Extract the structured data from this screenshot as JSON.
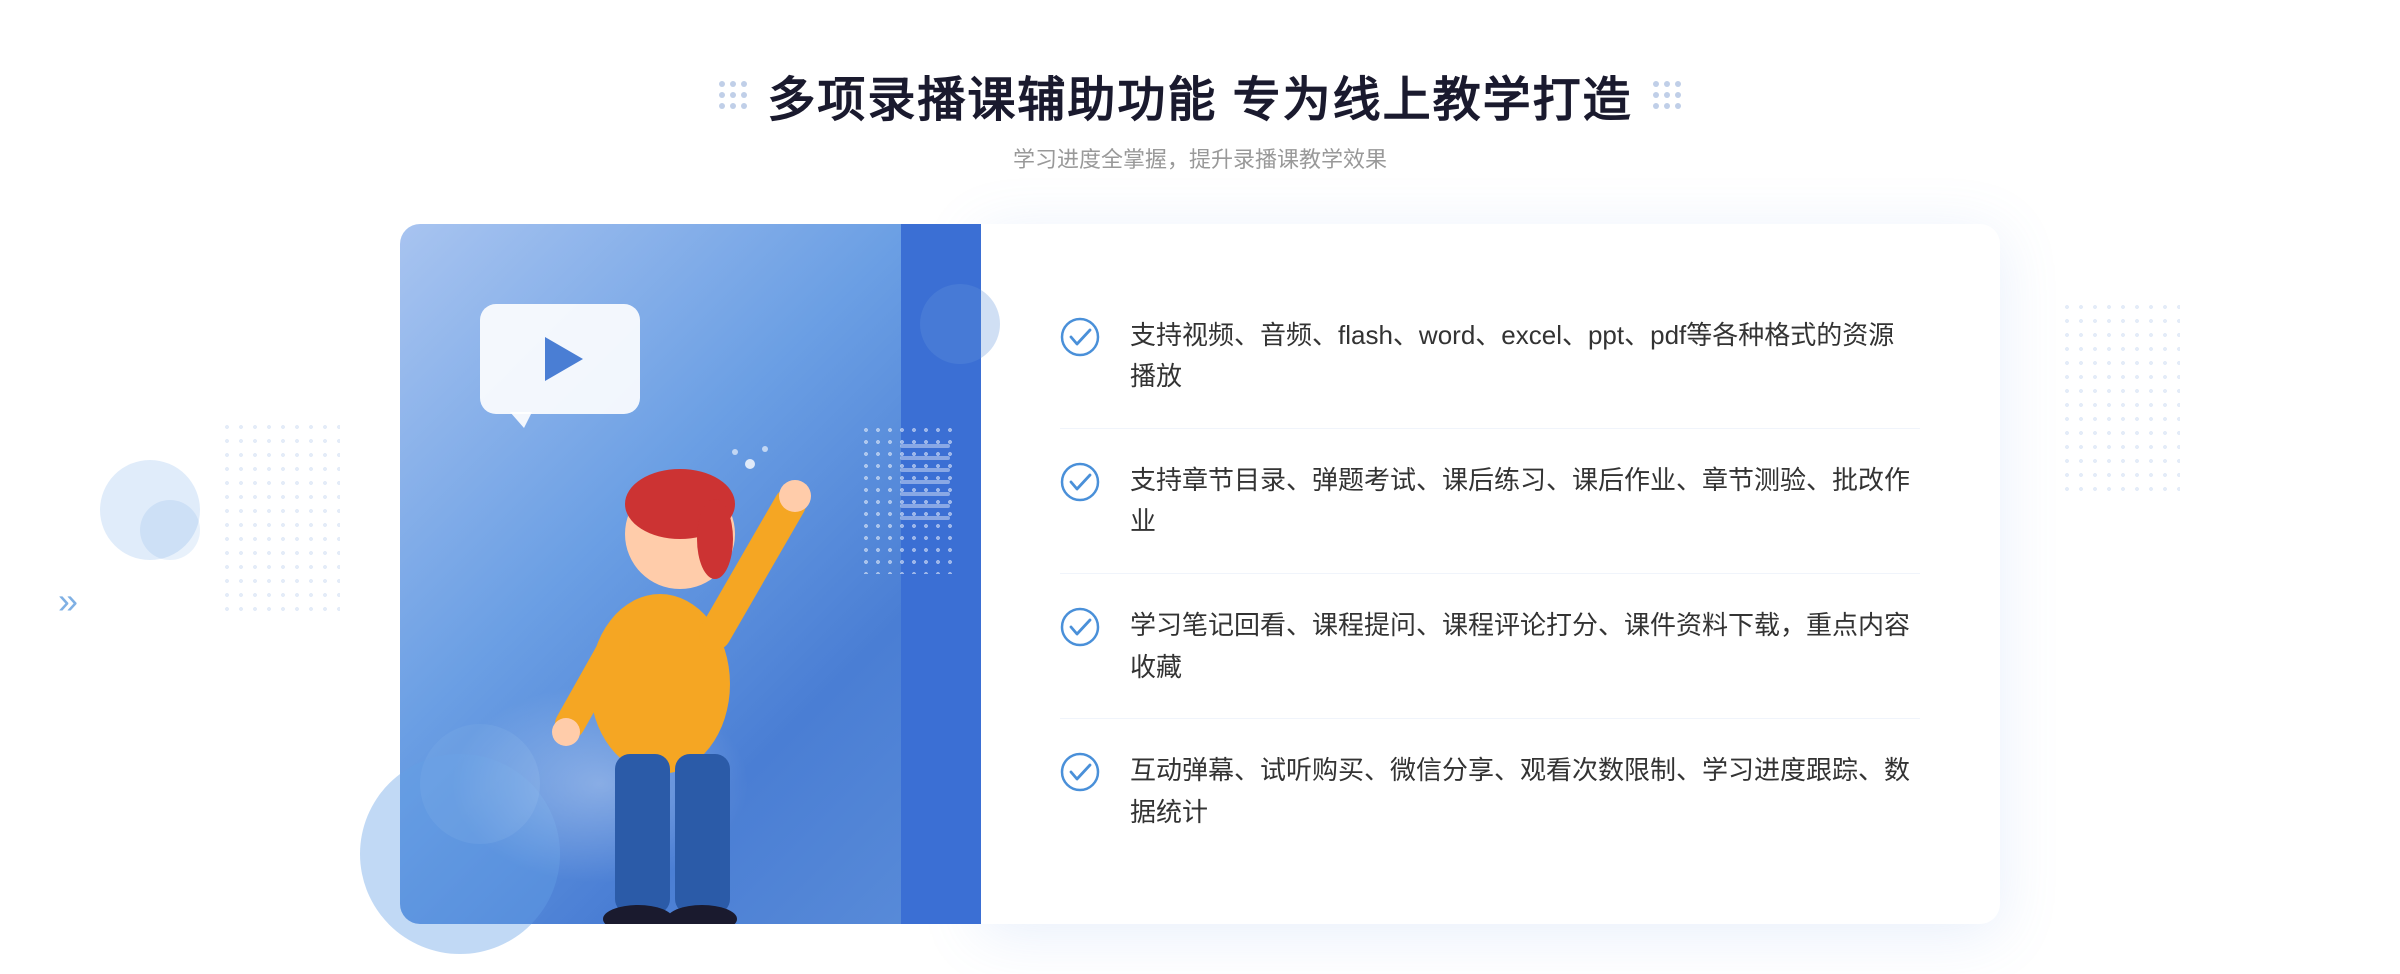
{
  "page": {
    "title": "多项录播课辅助功能 专为线上教学打造",
    "subtitle": "学习进度全掌握，提升录播课教学效果",
    "title_decorator_left": "decorators",
    "title_decorator_right": "decorators"
  },
  "features": [
    {
      "id": "feature-1",
      "text": "支持视频、音频、flash、word、excel、ppt、pdf等各种格式的资源播放"
    },
    {
      "id": "feature-2",
      "text": "支持章节目录、弹题考试、课后练习、课后作业、章节测验、批改作业"
    },
    {
      "id": "feature-3",
      "text": "学习笔记回看、课程提问、课程评论打分、课件资料下载，重点内容收藏"
    },
    {
      "id": "feature-4",
      "text": "互动弹幕、试听购买、微信分享、观看次数限制、学习进度跟踪、数据统计"
    }
  ],
  "colors": {
    "primary_blue": "#4a7ed4",
    "light_blue": "#a8c4f0",
    "dark_blue": "#3b6fd4",
    "title_color": "#1a1a2e",
    "text_color": "#333333",
    "subtitle_color": "#999999",
    "check_color": "#4a90d9"
  },
  "icons": {
    "check": "check-circle",
    "play": "play-triangle",
    "chevron": "double-chevron"
  }
}
